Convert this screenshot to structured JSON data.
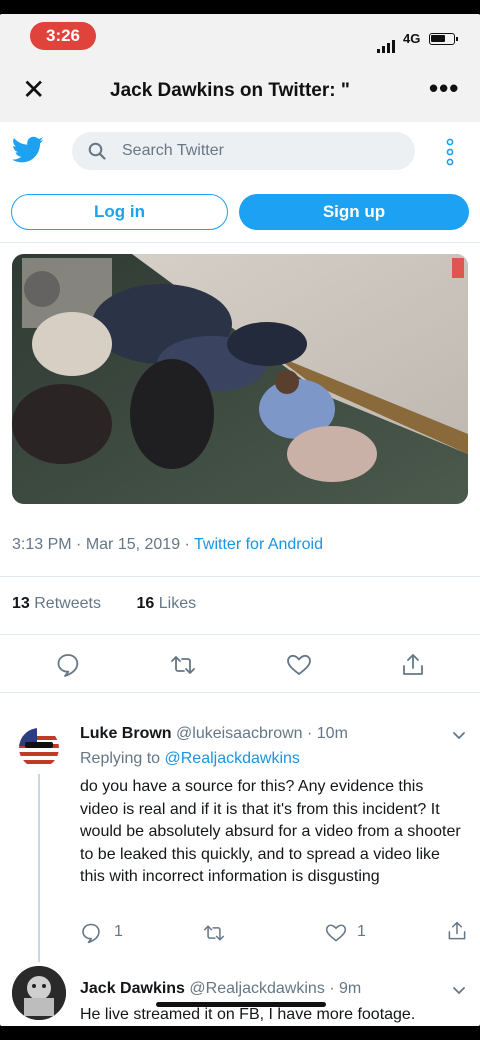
{
  "status_bar": {
    "time": "3:26",
    "network": "4G",
    "battery_level": 0.7
  },
  "header": {
    "title": "Jack Dawkins on Twitter: \"",
    "close_icon": "close-icon",
    "more_icon": "more-icon"
  },
  "topbar": {
    "search_placeholder": "Search Twitter"
  },
  "auth": {
    "login_label": "Log in",
    "signup_label": "Sign up"
  },
  "tweet": {
    "time": "3:13 PM",
    "sep1": " · ",
    "date": "Mar 15, 2019",
    "sep2": " · ",
    "source": "Twitter for Android",
    "retweets_count": "13",
    "retweets_label": "Retweets",
    "likes_count": "16",
    "likes_label": "Likes"
  },
  "replies": [
    {
      "name": "Luke Brown",
      "handle": "@lukeisaacbrown",
      "dot": " · ",
      "time": "10m",
      "replying_label": "Replying to ",
      "replying_handle": "@Realjackdawkins",
      "text": "do you have a source for this? Any evidence this video is real and if it is that it's from this incident? It would be absolutely absurd for a video from a shooter to be leaked this quickly, and to spread a video like this with incorrect information is disgusting",
      "reply_count": "1",
      "like_count": "1"
    },
    {
      "name": "Jack Dawkins",
      "handle": "@Realjackdawkins",
      "dot": " · ",
      "time": "9m",
      "text": "He live streamed it on FB, I have more footage."
    }
  ],
  "colors": {
    "twitter_blue": "#1da1f2",
    "link_blue": "#1b95e0",
    "status_red": "#e0433c"
  }
}
